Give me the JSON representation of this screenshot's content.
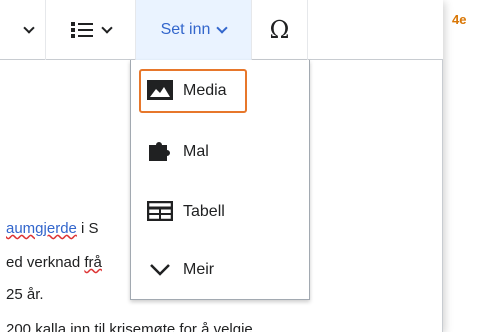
{
  "corner_label": "4e",
  "toolbar": {
    "insert_label": "Set inn",
    "special_char": "Ω"
  },
  "body_text": {
    "line1_link": "aumgjerde",
    "line1_tail": " i S",
    "line2_pre": "ed verknad ",
    "line2_link": "frå",
    "line3": "25 år.",
    "line4": "200 kalla inn til krisemøte for å velgje"
  },
  "insert_menu": {
    "items": [
      {
        "label": "Media",
        "icon": "image-icon"
      },
      {
        "label": "Mal",
        "icon": "puzzle-icon"
      },
      {
        "label": "Tabell",
        "icon": "table-icon"
      },
      {
        "label": "Meir",
        "icon": "chevron-down-icon"
      }
    ]
  }
}
